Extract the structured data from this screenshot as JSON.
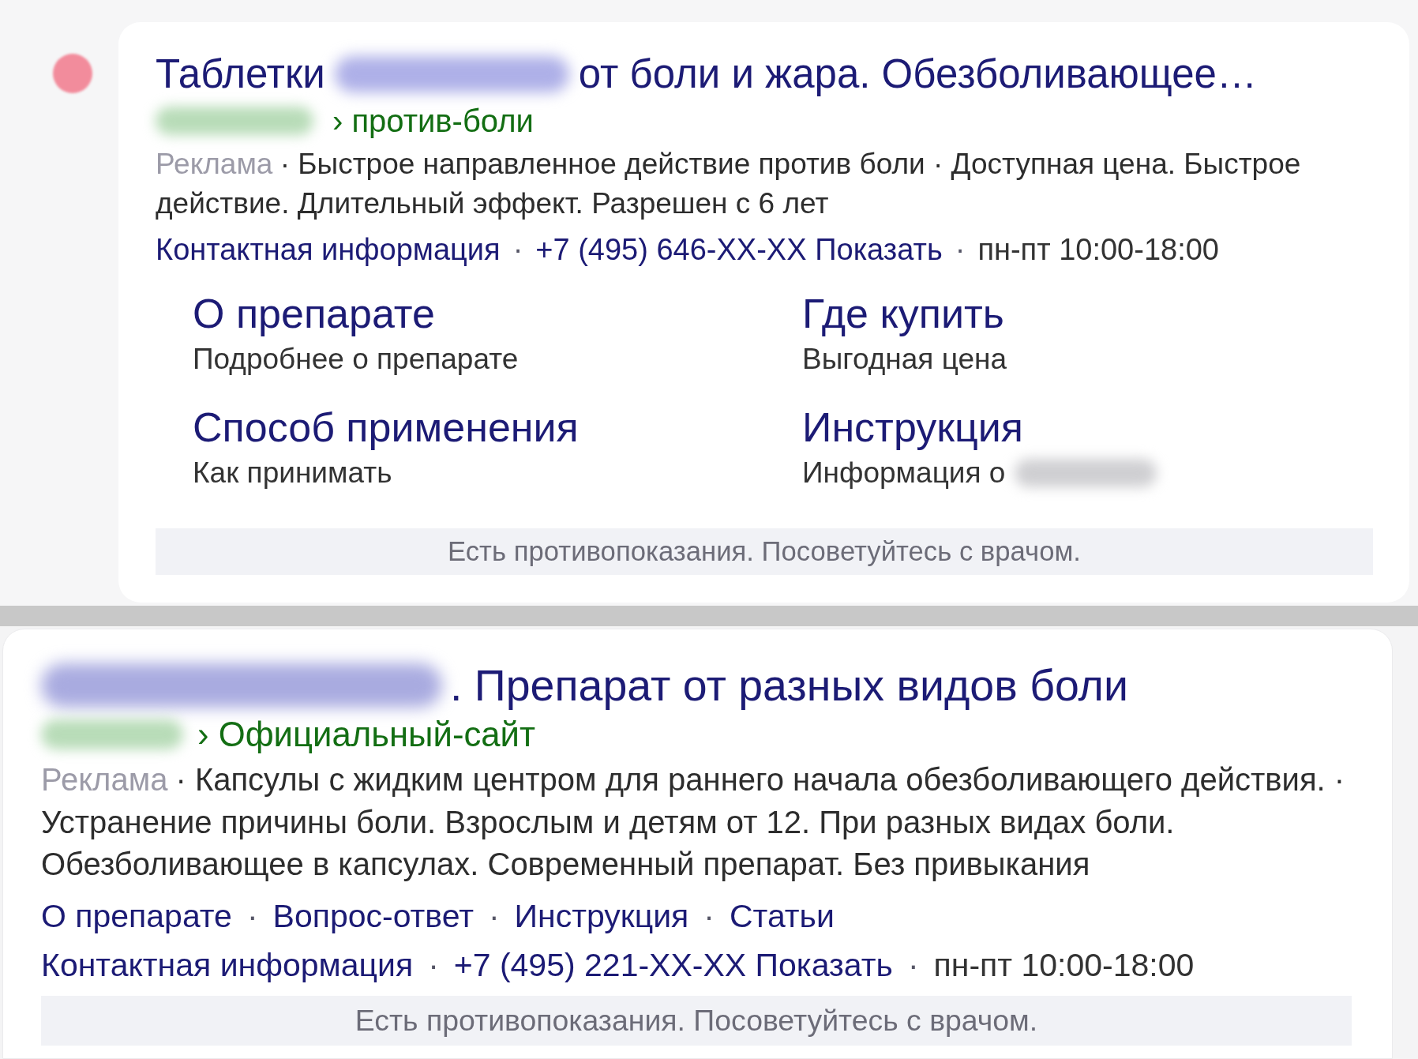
{
  "ads": [
    {
      "kind": "expanded",
      "dot": true,
      "title": [
        {
          "kind": "text",
          "text": "Таблетки"
        },
        {
          "kind": "redacted"
        },
        {
          "kind": "text",
          "text": "от боли и жара. Обезболивающее…"
        }
      ],
      "url": [
        {
          "kind": "redacted"
        },
        {
          "kind": "text",
          "text": "› против-боли"
        }
      ],
      "label": "Реклама",
      "description": "· Быстрое направленное действие против боли · Доступная цена. Быстрое\nдействие. Длительный эффект. Разрешен с 6 лет",
      "contacts": [
        {
          "kind": "link",
          "text": "Контактная информация"
        },
        {
          "kind": "separator",
          "text": "·"
        },
        {
          "kind": "link",
          "text": "+7 (495) 646-XX-XX"
        },
        {
          "kind": "link",
          "text": "Показать"
        },
        {
          "kind": "separator",
          "text": "·"
        },
        {
          "kind": "plain",
          "text": "пн-пт 10:00-18:00"
        }
      ],
      "sitelinks": [
        {
          "title": "О препарате",
          "subtitle": "Подробнее о препарате",
          "redacted_tail": false
        },
        {
          "title": "Где купить",
          "subtitle": "Выгодная цена",
          "redacted_tail": false
        },
        {
          "title": "Способ применения",
          "subtitle": "Как принимать",
          "redacted_tail": false
        },
        {
          "title": "Инструкция",
          "subtitle": "Информация о",
          "redacted_tail": true
        }
      ],
      "warning": "Есть противопоказания. Посоветуйтесь с врачом."
    },
    {
      "kind": "compact",
      "dot": false,
      "title": [
        {
          "kind": "redacted"
        },
        {
          "kind": "text",
          "text": ". Препарат от разных видов боли"
        }
      ],
      "url": [
        {
          "kind": "redacted"
        },
        {
          "kind": "text",
          "text": "› Официальный-сайт"
        }
      ],
      "label": "Реклама",
      "description": "· Капсулы с жидким центром для раннего начала обезболивающего действия. ·\nУстранение причины боли. Взрослым и детям от 12. При разных видах боли.\nОбезболивающее в капсулах. Современный препарат. Без привыкания",
      "sitelinks": [
        {
          "kind": "link",
          "text": "О препарате"
        },
        {
          "kind": "separator",
          "text": "·"
        },
        {
          "kind": "link",
          "text": "Вопрос-ответ"
        },
        {
          "kind": "separator",
          "text": "·"
        },
        {
          "kind": "link",
          "text": "Инструкция"
        },
        {
          "kind": "separator",
          "text": "·"
        },
        {
          "kind": "link",
          "text": "Статьи"
        }
      ],
      "contacts": [
        {
          "kind": "link",
          "text": "Контактная информация"
        },
        {
          "kind": "separator",
          "text": "·"
        },
        {
          "kind": "link",
          "text": "+7 (495) 221-XX-XX"
        },
        {
          "kind": "link",
          "text": "Показать"
        },
        {
          "kind": "separator",
          "text": "·"
        },
        {
          "kind": "plain",
          "text": "пн-пт 10:00-18:00"
        }
      ],
      "warning": "Есть противопоказания. Посоветуйтесь с врачом."
    }
  ]
}
